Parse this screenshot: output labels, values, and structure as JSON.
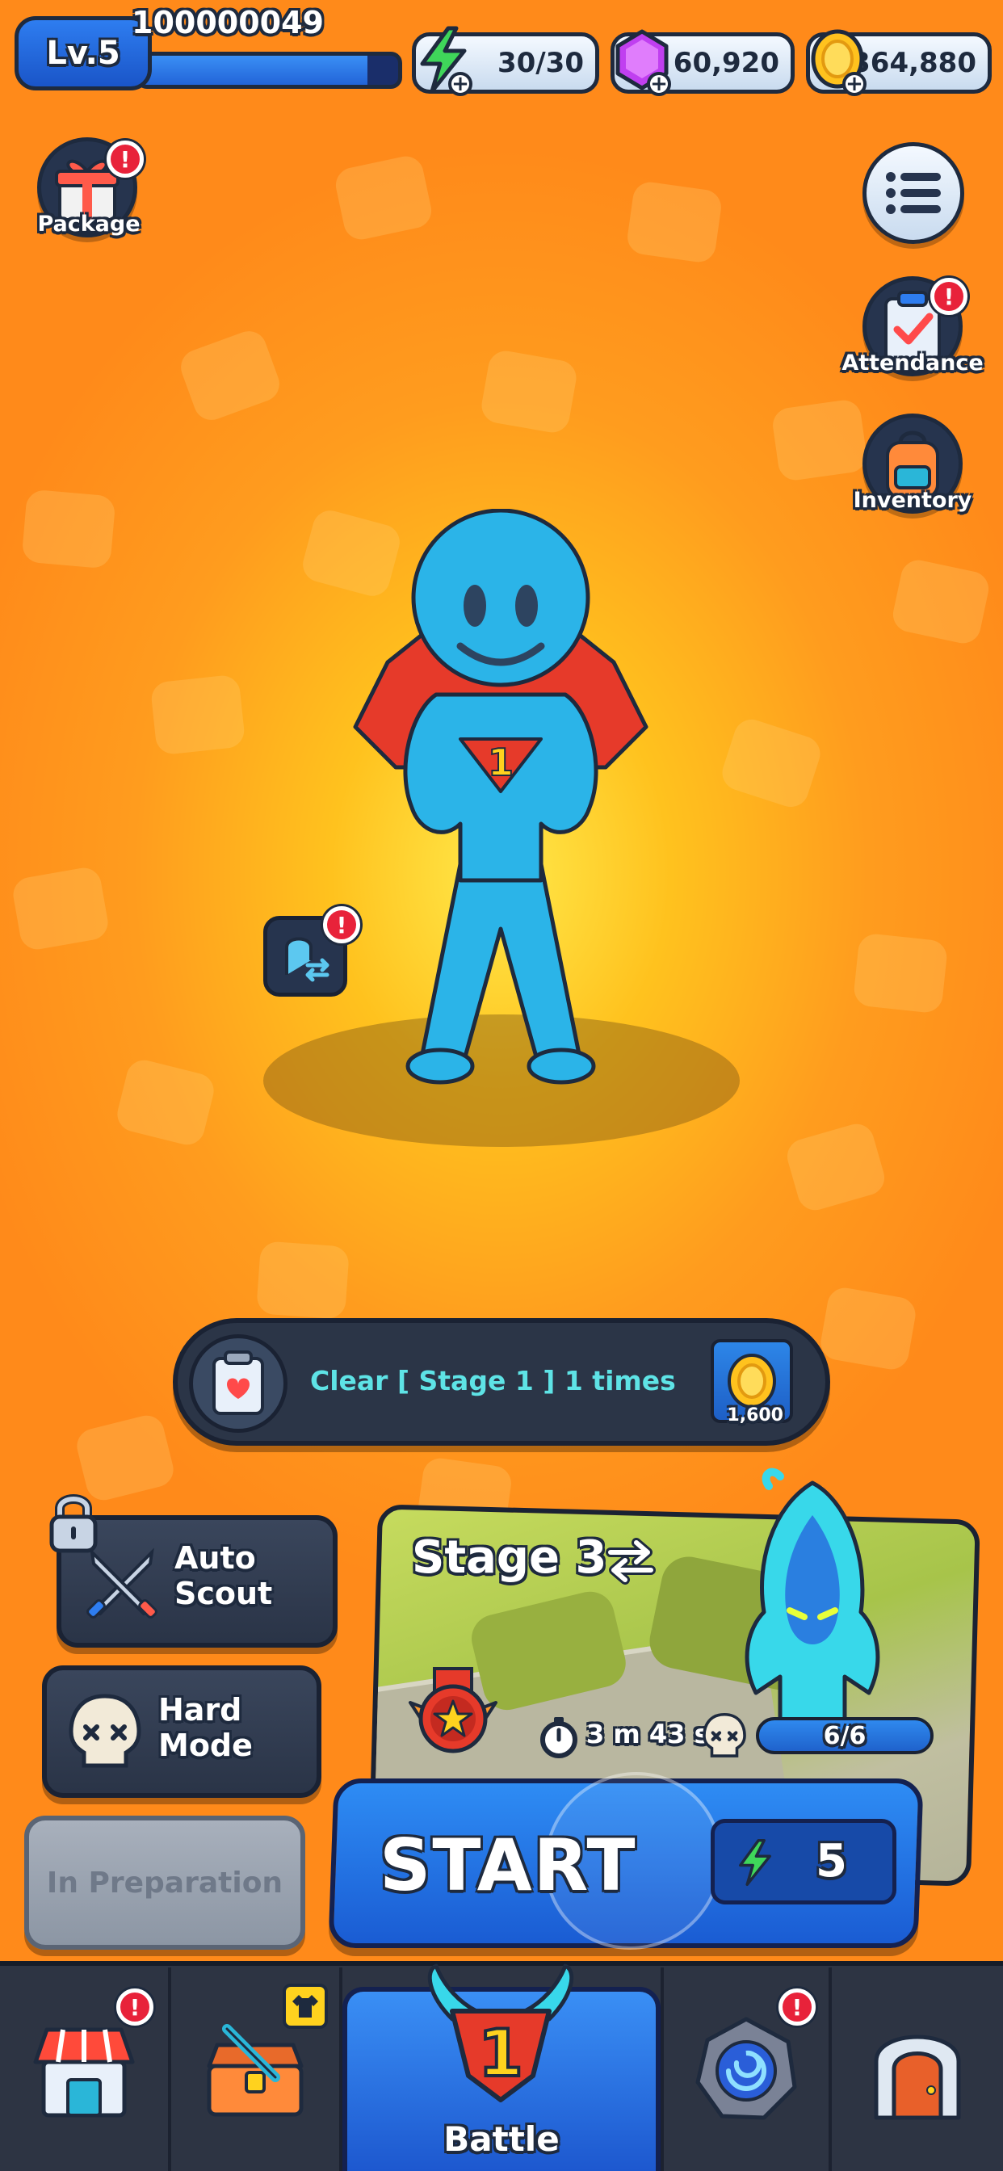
{
  "player": {
    "level_label": "Lv.5",
    "id": "100000049",
    "xp_progress": 0.88
  },
  "resources": {
    "energy": "30/30",
    "gems": "60,920",
    "coins": "364,880"
  },
  "side_buttons": {
    "package": "Package",
    "attendance": "Attendance",
    "inventory": "Inventory"
  },
  "quest": {
    "text": "Clear [ Stage 1 ] 1 times",
    "reward": "1,600"
  },
  "menu": {
    "auto_scout": "Auto\nScout",
    "hard_mode": "Hard\nMode",
    "in_preparation": "In Preparation"
  },
  "stage": {
    "title": "Stage 3",
    "timer": "3 m 43 s",
    "progress": "6/6"
  },
  "start": {
    "label": "START",
    "cost": "5"
  },
  "nav": {
    "battle": "Battle"
  },
  "character": {
    "chest_number": "1"
  },
  "colors": {
    "background": "#ff9c1e",
    "accent_blue": "#2e8cf4",
    "panel_dark": "#2b3547",
    "alert_red": "#e8223a",
    "quest_text": "#5ee3e6"
  }
}
